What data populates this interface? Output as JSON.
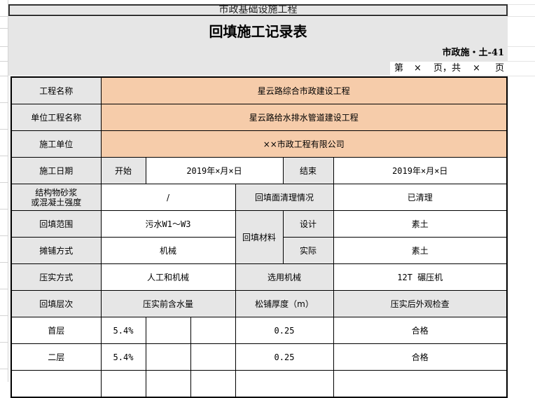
{
  "header": {
    "band_title": "市政基础设施工程",
    "form_title": "回填施工记录表",
    "form_code": "市政施・土-41",
    "page": {
      "prefix": "第",
      "num": "×",
      "mid": "页，共",
      "total": "×",
      "suffix": "页"
    }
  },
  "rows": {
    "project_name": {
      "label": "工程名称",
      "value": "星云路综合市政建设工程"
    },
    "unit_project_name": {
      "label": "单位工程名称",
      "value": "星云路给水排水管道建设工程"
    },
    "contractor": {
      "label": "施工单位",
      "value": "××市政工程有限公司"
    },
    "construction_date": {
      "label": "施工日期",
      "start_label": "开始",
      "start_value": "2019年×月×日",
      "end_label": "结束",
      "end_value": "2019年×月×日"
    },
    "strength": {
      "label_line1": "结构物砂浆",
      "label_line2": "或混凝土强度",
      "value": "/",
      "clean_label": "回填面清理情况",
      "clean_value": "已清理"
    },
    "backfill_range": {
      "label": "回填范围",
      "value": "污水W1～W3",
      "material_label": "回填材料",
      "design_label": "设计",
      "design_value": "素土"
    },
    "spreading": {
      "label": "摊铺方式",
      "value": "机械",
      "actual_label": "实际",
      "actual_value": "素土"
    },
    "compaction": {
      "label": "压实方式",
      "value": "人工和机械",
      "machine_label": "选用机械",
      "machine_value": "12T 碾压机"
    },
    "layers_header": {
      "label": "回填层次",
      "moisture_label": "压实前含水量",
      "thickness_label": "松铺厚度（m）",
      "inspection_label": "压实后外观检查"
    },
    "layers": [
      {
        "name": "首层",
        "moisture": "5.4%",
        "thickness": "0.25",
        "inspection": "合格"
      },
      {
        "name": "二层",
        "moisture": "5.4%",
        "thickness": "0.25",
        "inspection": "合格"
      }
    ]
  }
}
